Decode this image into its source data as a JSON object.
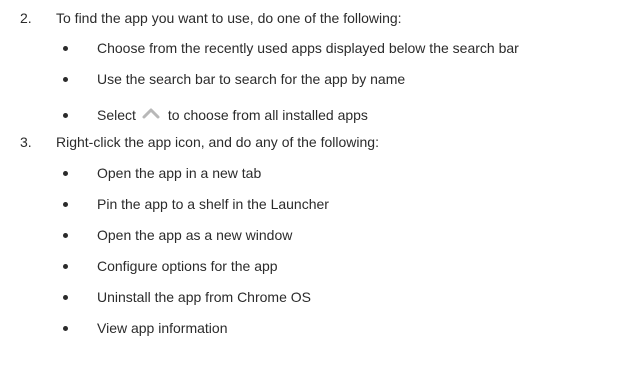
{
  "steps": [
    {
      "number": "2.",
      "text": "To find the app you want to use, do one of the following:",
      "bullets": [
        "Choose from the recently used apps displayed below the search bar",
        "Use the search bar to search for the app by name",
        {
          "before": "Select",
          "icon": "chevron-up-icon",
          "after": "to choose from all installed apps"
        }
      ]
    },
    {
      "number": "3.",
      "text": "Right-click the app icon, and do any of the following:",
      "bullets": [
        "Open the app in a new tab",
        "Pin the app to a shelf in the Launcher",
        "Open the app as a new window",
        "Configure options for the app",
        "Uninstall the app from Chrome OS",
        "View app information"
      ]
    }
  ],
  "colors": {
    "text": "#2b2b2b",
    "icon": "#b8b8b8"
  }
}
